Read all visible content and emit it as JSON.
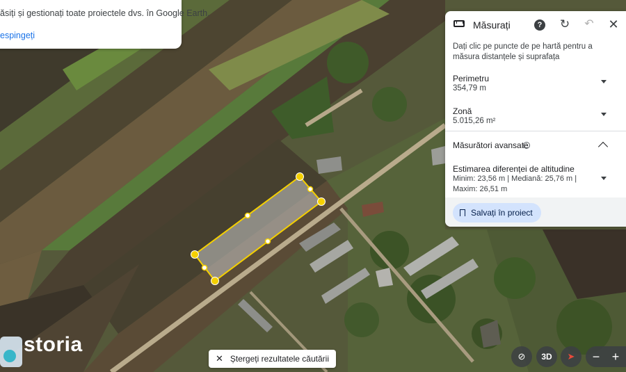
{
  "banner": {
    "text": "ăsiți și gestionați toate proiectele dvs. în Google Earth.",
    "link": "espingeți"
  },
  "measure_panel": {
    "title": "Măsurați",
    "description": "Dați clic pe puncte de pe hartă pentru a măsura distanțele și suprafața",
    "perimeter_label": "Perimetru",
    "perimeter_value": "354,79 m",
    "area_label": "Zonă",
    "area_value": "5.015,26 m²",
    "advanced_label": "Măsurători avansate",
    "altitude_label": "Estimarea diferenței de altitudine",
    "altitude_value": "Minim: 23,56 m | Mediană: 25,76 m | Maxim: 26,51 m",
    "save_label": "Salvați în proiect"
  },
  "bottom": {
    "clear_search_label": "Ștergeți rezultatele căutării",
    "btn_3d": "3D",
    "zoom_out": "−",
    "zoom_in": "+"
  },
  "watermark": "storia",
  "colors": {
    "accent": "#1a73e8",
    "polygon_stroke": "#f5d000",
    "save_button_bg": "#d3e3fd"
  }
}
